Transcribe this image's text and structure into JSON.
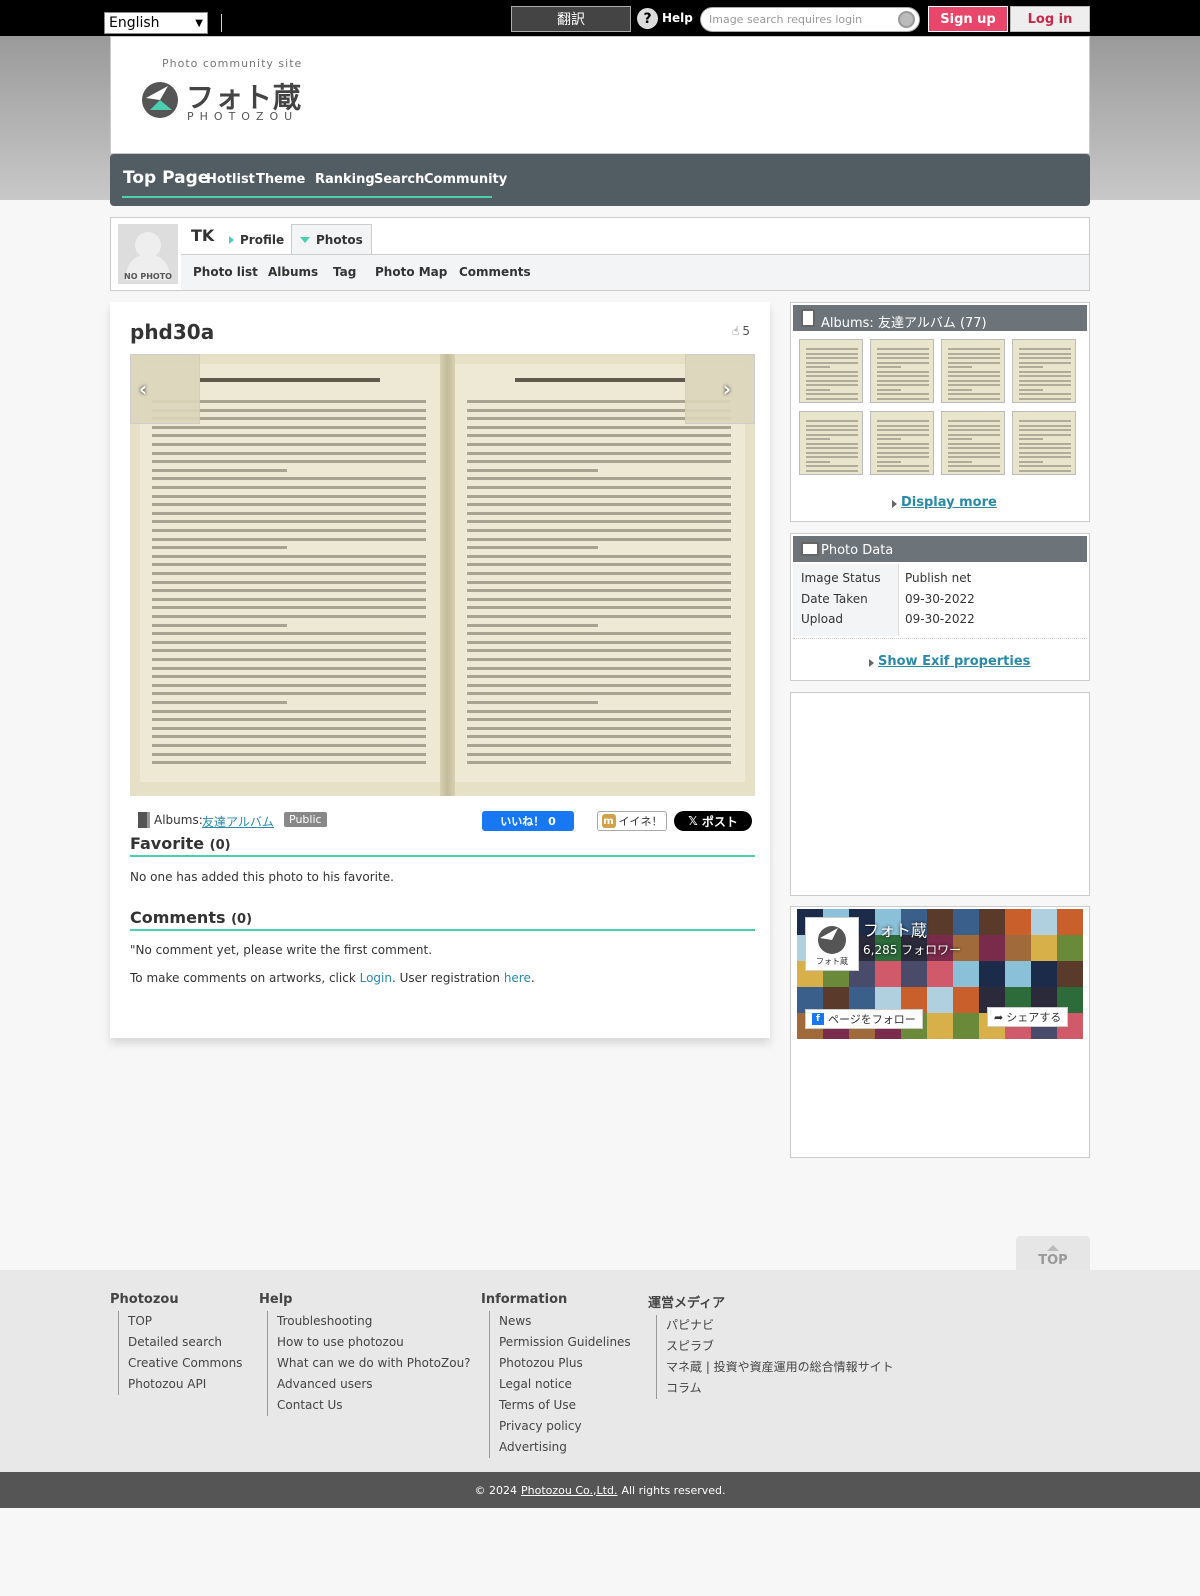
{
  "topbar": {
    "language": "English",
    "translate_label": "翻訳",
    "help_label": "Help",
    "search_placeholder": "Image search requires login",
    "signup_label": "Sign up",
    "login_label": "Log in"
  },
  "header": {
    "tagline": "Photo community site",
    "logo_jp": "フォト蔵",
    "logo_en": "PHOTOZOU"
  },
  "nav": {
    "items": [
      "Top Page",
      "Hotlist",
      "Theme",
      "Ranking",
      "Search",
      "Community"
    ]
  },
  "profile": {
    "avatar_label": "NO PHOTO",
    "username": "TK",
    "tabs": [
      "Profile",
      "Photos"
    ],
    "sub_items": [
      "Photo list",
      "Albums",
      "Tag",
      "Photo Map",
      "Comments"
    ]
  },
  "photo": {
    "title": "phd30a",
    "like_count": "5",
    "albums_label": "Albums:",
    "album_name": "友達アルバム",
    "visibility": "Public",
    "fb_like_label": "いいね！ 0",
    "mixi_label": "イイネ！",
    "x_label": "ポスト"
  },
  "favorite": {
    "title": "Favorite",
    "count": "(0)",
    "text": "No one has added this photo to his favorite."
  },
  "comments": {
    "title": "Comments",
    "count": "(0)",
    "empty_text": "\"No comment yet, please write the first comment.",
    "login_prefix": "To make comments on artworks, click ",
    "login_link": "Login",
    "register_prefix": ". User registration ",
    "register_link": "here",
    "register_suffix": "."
  },
  "album_box": {
    "title": "Albums: 友達アルバム (77)",
    "display_more": "Display more"
  },
  "photo_data": {
    "title": "Photo Data",
    "rows": [
      {
        "key": "Image Status",
        "value": "Publish net"
      },
      {
        "key": "Date Taken",
        "value": "09-30-2022"
      },
      {
        "key": "Upload",
        "value": "09-30-2022"
      }
    ],
    "exif_link": "Show Exif properties"
  },
  "fb_widget": {
    "page_name": "フォト蔵",
    "followers": "6,285 フォロワー",
    "follow_label": "ページをフォロー",
    "share_label": "シェアする",
    "logo_text": "フォト蔵"
  },
  "top_button": "TOP",
  "footer": {
    "columns": [
      {
        "head": "Photozou",
        "items": [
          "TOP",
          "Detailed search",
          "Creative Commons",
          "Photozou API"
        ]
      },
      {
        "head": "Help",
        "items": [
          "Troubleshooting",
          "How to use photozou",
          "What can we do with PhotoZou?",
          "Advanced users",
          "Contact Us"
        ]
      },
      {
        "head": "Information",
        "items": [
          "News",
          "Permission Guidelines",
          "Photozou Plus",
          "Legal notice",
          "Terms of Use",
          "Privacy policy",
          "Advertising"
        ]
      },
      {
        "head": "運営メディア",
        "items": [
          "パピナビ",
          "スピラブ",
          "マネ蔵 | 投資や資産運用の総合情報サイト",
          "コラム"
        ]
      }
    ],
    "copyright_prefix": "© 2024",
    "copyright_link": "Photozou Co.,Ltd.",
    "copyright_suffix": "All rights reserved."
  },
  "colors": {
    "accent": "#4ccfb0",
    "nav_bg": "#525c63",
    "signup": "#e8466a",
    "link": "#2a8aa8"
  }
}
